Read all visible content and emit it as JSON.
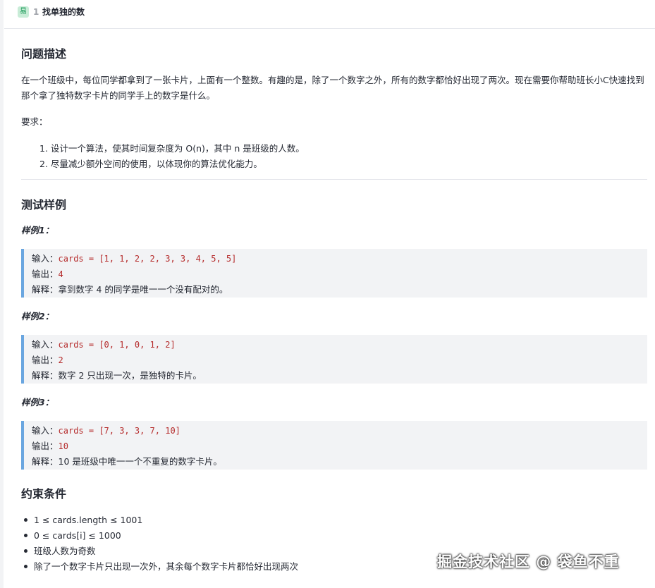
{
  "header": {
    "difficulty_badge": "易",
    "question_number": "1",
    "title": "找单独的数"
  },
  "sections": {
    "description_heading": "问题描述",
    "description_text": "在一个班级中，每位同学都拿到了一张卡片，上面有一个整数。有趣的是，除了一个数字之外，所有的数字都恰好出现了两次。现在需要你帮助班长小C快速找到那个拿了独特数字卡片的同学手上的数字是什么。",
    "requirements_label": "要求：",
    "requirements": [
      "1. 设计一个算法，使其时间复杂度为 O(n)，其中 n 是班级的人数。",
      "2. 尽量减少额外空间的使用，以体现你的算法优化能力。"
    ],
    "examples_heading": "测试样例",
    "constraints_heading": "约束条件"
  },
  "examples": [
    {
      "title": "样例1：",
      "input_label": "输入：",
      "input_code": "cards = [1, 1, 2, 2, 3, 3, 4, 5, 5]",
      "output_label": "输出：",
      "output_code": "4",
      "explain_label": "解释：",
      "explain_text": "拿到数字 4 的同学是唯一一个没有配对的。"
    },
    {
      "title": "样例2：",
      "input_label": "输入：",
      "input_code": "cards = [0, 1, 0, 1, 2]",
      "output_label": "输出：",
      "output_code": "2",
      "explain_label": "解释：",
      "explain_text": "数字 2 只出现一次，是独特的卡片。"
    },
    {
      "title": "样例3：",
      "input_label": "输入：",
      "input_code": "cards = [7, 3, 3, 7, 10]",
      "output_label": "输出：",
      "output_code": "10",
      "explain_label": "解释：",
      "explain_text": "10 是班级中唯一一个不重复的数字卡片。"
    }
  ],
  "constraints": [
    "1 ≤ cards.length ≤ 1001",
    "0 ≤ cards[i] ≤ 1000",
    "班级人数为奇数",
    "除了一个数字卡片只出现一次外，其余每个数字卡片都恰好出现两次"
  ],
  "watermark": "掘金技术社区 @ 袋鱼不重",
  "colors": {
    "code_red": "#b52b2b",
    "blockquote_border": "#6aa6e0",
    "blockquote_bg": "#f2f3f5",
    "badge_green": "#1d9b5a"
  }
}
